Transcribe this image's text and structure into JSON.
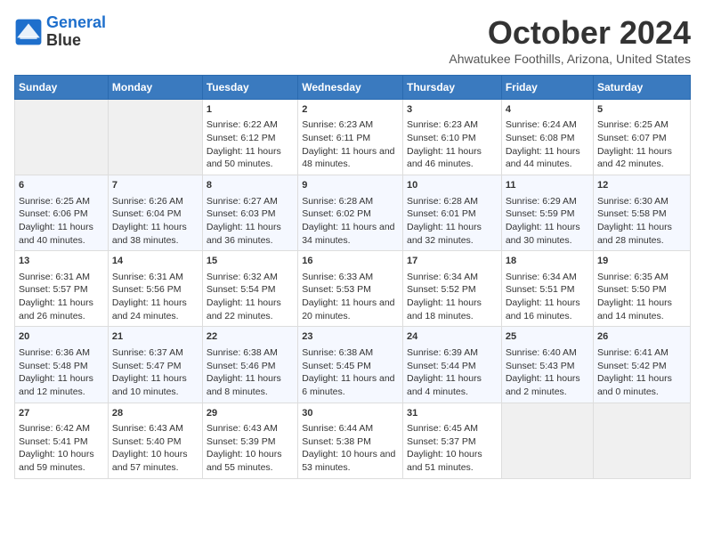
{
  "header": {
    "logo_line1": "General",
    "logo_line2": "Blue",
    "month_title": "October 2024",
    "location": "Ahwatukee Foothills, Arizona, United States"
  },
  "weekdays": [
    "Sunday",
    "Monday",
    "Tuesday",
    "Wednesday",
    "Thursday",
    "Friday",
    "Saturday"
  ],
  "weeks": [
    [
      {
        "day": "",
        "empty": true
      },
      {
        "day": "",
        "empty": true
      },
      {
        "day": "1",
        "sunrise": "6:22 AM",
        "sunset": "6:12 PM",
        "daylight": "11 hours and 50 minutes."
      },
      {
        "day": "2",
        "sunrise": "6:23 AM",
        "sunset": "6:11 PM",
        "daylight": "11 hours and 48 minutes."
      },
      {
        "day": "3",
        "sunrise": "6:23 AM",
        "sunset": "6:10 PM",
        "daylight": "11 hours and 46 minutes."
      },
      {
        "day": "4",
        "sunrise": "6:24 AM",
        "sunset": "6:08 PM",
        "daylight": "11 hours and 44 minutes."
      },
      {
        "day": "5",
        "sunrise": "6:25 AM",
        "sunset": "6:07 PM",
        "daylight": "11 hours and 42 minutes."
      }
    ],
    [
      {
        "day": "6",
        "sunrise": "6:25 AM",
        "sunset": "6:06 PM",
        "daylight": "11 hours and 40 minutes."
      },
      {
        "day": "7",
        "sunrise": "6:26 AM",
        "sunset": "6:04 PM",
        "daylight": "11 hours and 38 minutes."
      },
      {
        "day": "8",
        "sunrise": "6:27 AM",
        "sunset": "6:03 PM",
        "daylight": "11 hours and 36 minutes."
      },
      {
        "day": "9",
        "sunrise": "6:28 AM",
        "sunset": "6:02 PM",
        "daylight": "11 hours and 34 minutes."
      },
      {
        "day": "10",
        "sunrise": "6:28 AM",
        "sunset": "6:01 PM",
        "daylight": "11 hours and 32 minutes."
      },
      {
        "day": "11",
        "sunrise": "6:29 AM",
        "sunset": "5:59 PM",
        "daylight": "11 hours and 30 minutes."
      },
      {
        "day": "12",
        "sunrise": "6:30 AM",
        "sunset": "5:58 PM",
        "daylight": "11 hours and 28 minutes."
      }
    ],
    [
      {
        "day": "13",
        "sunrise": "6:31 AM",
        "sunset": "5:57 PM",
        "daylight": "11 hours and 26 minutes."
      },
      {
        "day": "14",
        "sunrise": "6:31 AM",
        "sunset": "5:56 PM",
        "daylight": "11 hours and 24 minutes."
      },
      {
        "day": "15",
        "sunrise": "6:32 AM",
        "sunset": "5:54 PM",
        "daylight": "11 hours and 22 minutes."
      },
      {
        "day": "16",
        "sunrise": "6:33 AM",
        "sunset": "5:53 PM",
        "daylight": "11 hours and 20 minutes."
      },
      {
        "day": "17",
        "sunrise": "6:34 AM",
        "sunset": "5:52 PM",
        "daylight": "11 hours and 18 minutes."
      },
      {
        "day": "18",
        "sunrise": "6:34 AM",
        "sunset": "5:51 PM",
        "daylight": "11 hours and 16 minutes."
      },
      {
        "day": "19",
        "sunrise": "6:35 AM",
        "sunset": "5:50 PM",
        "daylight": "11 hours and 14 minutes."
      }
    ],
    [
      {
        "day": "20",
        "sunrise": "6:36 AM",
        "sunset": "5:48 PM",
        "daylight": "11 hours and 12 minutes."
      },
      {
        "day": "21",
        "sunrise": "6:37 AM",
        "sunset": "5:47 PM",
        "daylight": "11 hours and 10 minutes."
      },
      {
        "day": "22",
        "sunrise": "6:38 AM",
        "sunset": "5:46 PM",
        "daylight": "11 hours and 8 minutes."
      },
      {
        "day": "23",
        "sunrise": "6:38 AM",
        "sunset": "5:45 PM",
        "daylight": "11 hours and 6 minutes."
      },
      {
        "day": "24",
        "sunrise": "6:39 AM",
        "sunset": "5:44 PM",
        "daylight": "11 hours and 4 minutes."
      },
      {
        "day": "25",
        "sunrise": "6:40 AM",
        "sunset": "5:43 PM",
        "daylight": "11 hours and 2 minutes."
      },
      {
        "day": "26",
        "sunrise": "6:41 AM",
        "sunset": "5:42 PM",
        "daylight": "11 hours and 0 minutes."
      }
    ],
    [
      {
        "day": "27",
        "sunrise": "6:42 AM",
        "sunset": "5:41 PM",
        "daylight": "10 hours and 59 minutes."
      },
      {
        "day": "28",
        "sunrise": "6:43 AM",
        "sunset": "5:40 PM",
        "daylight": "10 hours and 57 minutes."
      },
      {
        "day": "29",
        "sunrise": "6:43 AM",
        "sunset": "5:39 PM",
        "daylight": "10 hours and 55 minutes."
      },
      {
        "day": "30",
        "sunrise": "6:44 AM",
        "sunset": "5:38 PM",
        "daylight": "10 hours and 53 minutes."
      },
      {
        "day": "31",
        "sunrise": "6:45 AM",
        "sunset": "5:37 PM",
        "daylight": "10 hours and 51 minutes."
      },
      {
        "day": "",
        "empty": true
      },
      {
        "day": "",
        "empty": true
      }
    ]
  ],
  "labels": {
    "sunrise": "Sunrise:",
    "sunset": "Sunset:",
    "daylight": "Daylight:"
  }
}
